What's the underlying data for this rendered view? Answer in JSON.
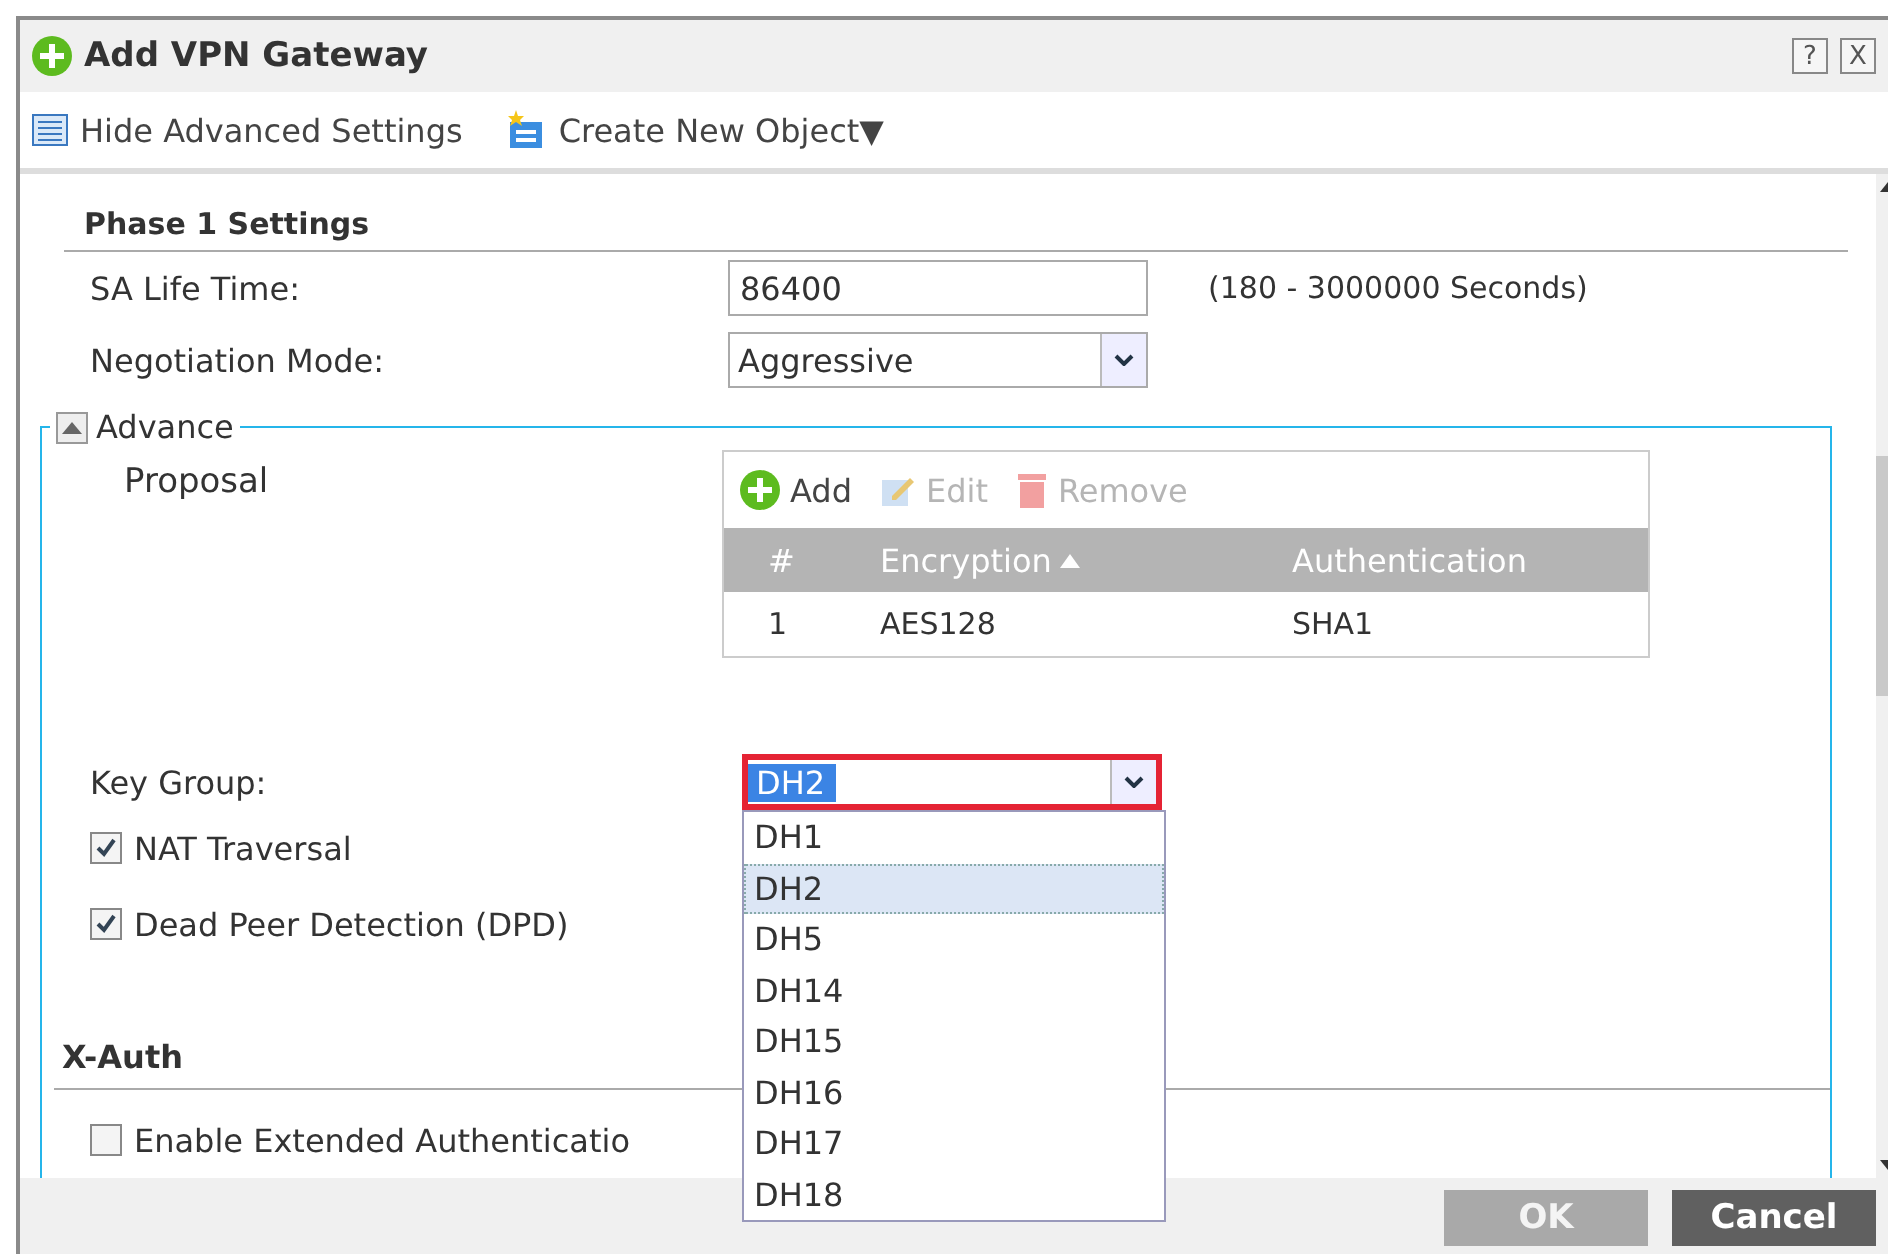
{
  "window": {
    "title": "Add VPN Gateway",
    "help": "?",
    "close": "X"
  },
  "toolbar": [
    {
      "label": "Hide Advanced Settings"
    },
    {
      "label": "Create New Object▼"
    }
  ],
  "phase1": {
    "heading": "Phase 1 Settings",
    "fields": [
      {
        "kind": "text",
        "label": "SA Life Time:",
        "value": "86400",
        "hint": "(180 - 3000000 Seconds)"
      },
      {
        "kind": "select",
        "label": "Negotiation Mode:",
        "value": "Aggressive"
      }
    ]
  },
  "advance": {
    "label": "Advance",
    "expanded": true,
    "proposal": {
      "label": "Proposal",
      "actions": [
        {
          "label": "Add",
          "disabled": false
        },
        {
          "label": "Edit",
          "disabled": true
        },
        {
          "label": "Remove",
          "disabled": true
        }
      ],
      "columns": [
        {
          "label": "#",
          "sorted": false
        },
        {
          "label": "Encryption",
          "sorted": true
        },
        {
          "label": "Authentication",
          "sorted": false
        }
      ],
      "rows": [
        [
          "1",
          "AES128",
          "SHA1"
        ]
      ]
    },
    "key_group": {
      "label": "Key Group:",
      "value": "DH2",
      "open": true,
      "options": [
        {
          "label": "DH1",
          "selected": false
        },
        {
          "label": "DH2",
          "selected": true
        },
        {
          "label": "DH5",
          "selected": false
        },
        {
          "label": "DH14",
          "selected": false
        },
        {
          "label": "DH15",
          "selected": false
        },
        {
          "label": "DH16",
          "selected": false
        },
        {
          "label": "DH17",
          "selected": false
        },
        {
          "label": "DH18",
          "selected": false
        }
      ]
    },
    "checks": [
      {
        "label": "NAT Traversal",
        "checked": true
      },
      {
        "label": "Dead Peer Detection (DPD)",
        "checked": true
      }
    ]
  },
  "xauth": {
    "heading": "X-Auth",
    "checks": [
      {
        "label": "Enable Extended Authenticatio",
        "checked": false
      }
    ]
  },
  "buttons": [
    {
      "label": "OK",
      "disabled": true
    },
    {
      "label": "Cancel",
      "disabled": false
    }
  ]
}
